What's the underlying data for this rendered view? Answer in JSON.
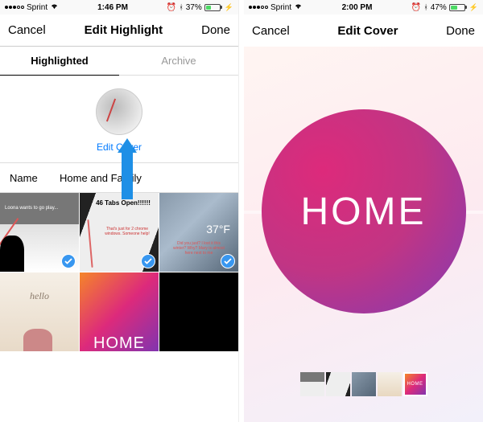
{
  "left": {
    "status": {
      "carrier": "Sprint",
      "time": "1:46 PM",
      "battery_pct": "37%",
      "battery_fill": 37
    },
    "nav": {
      "cancel": "Cancel",
      "title": "Edit Highlight",
      "done": "Done"
    },
    "tabs": {
      "highlighted": "Highlighted",
      "archive": "Archive"
    },
    "cover": {
      "edit_link": "Edit Cover"
    },
    "name": {
      "label": "Name",
      "value": "Home and Family"
    },
    "tiles": {
      "t1_caption": "Loona wants to go play...",
      "t2_title": "46 Tabs Open!!!!!!",
      "t2_sub": "That's just for 2 chrome windows. Someone help!",
      "t3_temp": "37°F",
      "t3_caption": "Did you just? I lost it this winter? Why? Mary is almost here next to me",
      "t4_text": "hello",
      "t5_text": "HOME"
    }
  },
  "right": {
    "status": {
      "carrier": "Sprint",
      "time": "2:00 PM",
      "battery_pct": "47%",
      "battery_fill": 47
    },
    "nav": {
      "cancel": "Cancel",
      "title": "Edit Cover",
      "done": "Done"
    },
    "cover_text": "HOME",
    "thumbs": {
      "selected_text": "HOME"
    }
  }
}
